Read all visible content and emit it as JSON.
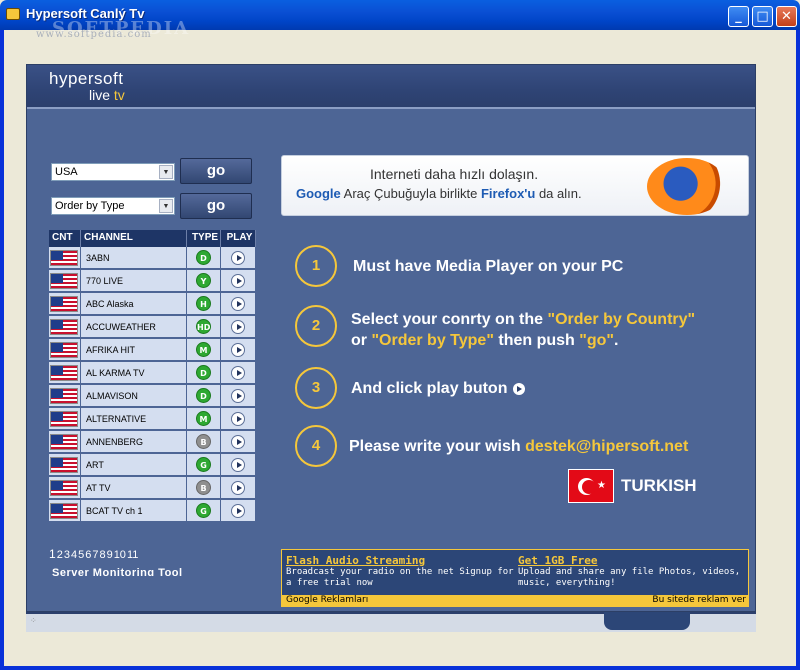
{
  "window": {
    "title": "Hypersoft Canlý Tv",
    "watermark": "www.softpedia.com",
    "watermark_big": "SOFTPEDIA",
    "min_glyph": "_",
    "max_glyph": "□",
    "close_glyph": "✕"
  },
  "header": {
    "logo_top": "hypersoft",
    "logo_live": "live",
    "logo_tv": "tv"
  },
  "controls": {
    "country_select": "USA",
    "order_select": "Order by Type",
    "go_label": "go",
    "select_arrow": "▼"
  },
  "table": {
    "headers": {
      "cnt": "CNT",
      "channel": "CHANNEL",
      "type": "TYPE",
      "play": "PLAY"
    },
    "rows": [
      {
        "channel": "3ABN",
        "type": "D",
        "type_color": "green"
      },
      {
        "channel": "770 LIVE",
        "type": "Y",
        "type_color": "green"
      },
      {
        "channel": "ABC Alaska",
        "type": "H",
        "type_color": "green"
      },
      {
        "channel": "ACCUWEATHER",
        "type": "HD",
        "type_color": "green"
      },
      {
        "channel": "AFRIKA HIT",
        "type": "M",
        "type_color": "green"
      },
      {
        "channel": "AL KARMA TV",
        "type": "D",
        "type_color": "green"
      },
      {
        "channel": "ALMAVISON",
        "type": "D",
        "type_color": "green"
      },
      {
        "channel": "ALTERNATIVE",
        "type": "M",
        "type_color": "green"
      },
      {
        "channel": "ANNENBERG",
        "type": "B",
        "type_color": "gray"
      },
      {
        "channel": "ART",
        "type": "G",
        "type_color": "green"
      },
      {
        "channel": "AT TV",
        "type": "B",
        "type_color": "gray"
      },
      {
        "channel": "BCAT TV ch 1",
        "type": "G",
        "type_color": "green"
      }
    ]
  },
  "pager": {
    "current": "1",
    "pages": [
      "2",
      "3",
      "4",
      "5",
      "6",
      "7",
      "8",
      "9",
      "10",
      "11"
    ]
  },
  "server_tool": "Server Monitoring Tool",
  "firefox_banner": {
    "line1": "Interneti daha hızlı dolaşın.",
    "google": "Google",
    "mid": " Araç Çubuğuyla birlikte ",
    "firefox": "Firefox'u",
    "end": " da alın."
  },
  "steps": {
    "s1": {
      "num": "1",
      "text": "Must have Media Player on your PC"
    },
    "s2": {
      "num": "2",
      "a": "Select your conrty on the ",
      "b": "\"Order by Country\"",
      "c": "or ",
      "d": "\"Order by Type\"",
      "e": "  then push ",
      "f": "\"go\"",
      "g": "."
    },
    "s3": {
      "num": "3",
      "text": "And click play buton"
    },
    "s4": {
      "num": "4",
      "text": "Please write your wish ",
      "email": "destek@hipersoft.net"
    }
  },
  "language": {
    "label": "TURKISH",
    "star": "★"
  },
  "ads": {
    "ad1": {
      "title": "Flash Audio Streaming",
      "text": "Broadcast your radio on the net Signup for a free trial now"
    },
    "ad2": {
      "title": "Get 1GB Free",
      "text": "Upload and share any file Photos, videos, music, everything!"
    },
    "footer_left": "Google Reklamları",
    "footer_right": "Bu sitede reklam ver"
  },
  "colors": {
    "accent": "#f5c73b",
    "panel": "#4d6595",
    "header": "#2f4475",
    "row": "#d4def0",
    "badge_green": "#2ea832",
    "badge_gray": "#8f8f8f"
  }
}
